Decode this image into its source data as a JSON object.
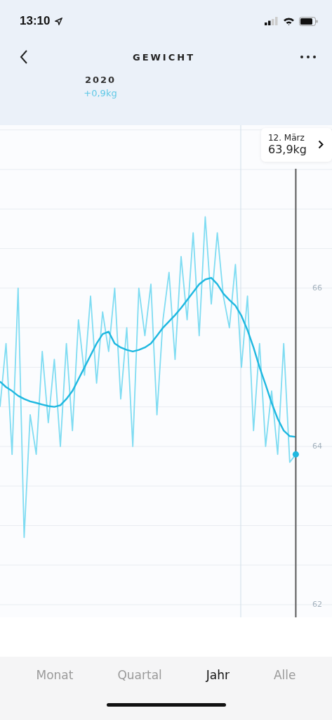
{
  "status_bar": {
    "time": "13:10"
  },
  "header": {
    "title": "GEWICHT"
  },
  "summary": {
    "period": "2020",
    "change": "+0,9kg"
  },
  "tooltip": {
    "date": "12. März",
    "value": "63,9kg"
  },
  "chart_data": {
    "type": "line",
    "grid": true,
    "ylim": [
      61.84,
      68.06
    ],
    "yticks": [
      62,
      64,
      66
    ],
    "categories": [
      null,
      null,
      null,
      null,
      null,
      null,
      null,
      null,
      null,
      null,
      null,
      null,
      null,
      null,
      null,
      null,
      null,
      null,
      null,
      null,
      null,
      null,
      null,
      null,
      null,
      null,
      null,
      null,
      null,
      null,
      null,
      null,
      null,
      null,
      null,
      null,
      null,
      null,
      null,
      null,
      null,
      null,
      null,
      null,
      null,
      null,
      null,
      null,
      null,
      null
    ],
    "series": [
      {
        "color": "#7fdcf2",
        "values": [
          64.5,
          65.3,
          63.9,
          66.0,
          62.85,
          64.4,
          63.9,
          65.2,
          64.3,
          65.1,
          64.0,
          65.3,
          64.2,
          65.6,
          64.9,
          65.9,
          64.8,
          65.7,
          65.2,
          66.0,
          64.6,
          65.5,
          64.0,
          66.0,
          65.4,
          66.05,
          64.4,
          65.6,
          66.2,
          65.1,
          66.4,
          65.6,
          66.7,
          65.4,
          66.9,
          65.8,
          66.7,
          65.9,
          65.5,
          66.3,
          65.0,
          65.9,
          64.2,
          65.3,
          64.0,
          64.7,
          63.9,
          65.3,
          63.8,
          63.9
        ]
      },
      {
        "color": "#1fb8e0",
        "values": [
          64.82,
          64.75,
          64.7,
          64.64,
          64.6,
          64.57,
          64.55,
          64.53,
          64.51,
          64.5,
          64.52,
          64.6,
          64.7,
          64.85,
          65.0,
          65.15,
          65.3,
          65.42,
          65.45,
          65.3,
          65.25,
          65.22,
          65.2,
          65.22,
          65.25,
          65.3,
          65.4,
          65.5,
          65.58,
          65.66,
          65.75,
          65.85,
          65.95,
          66.05,
          66.11,
          66.13,
          66.05,
          65.93,
          65.85,
          65.78,
          65.65,
          65.47,
          65.25,
          65.0,
          64.78,
          64.55,
          64.35,
          64.2,
          64.13,
          64.12
        ]
      }
    ]
  },
  "tabs": [
    {
      "label": "Monat",
      "selected": false
    },
    {
      "label": "Quartal",
      "selected": false
    },
    {
      "label": "Jahr",
      "selected": true
    },
    {
      "label": "Alle",
      "selected": false
    }
  ]
}
